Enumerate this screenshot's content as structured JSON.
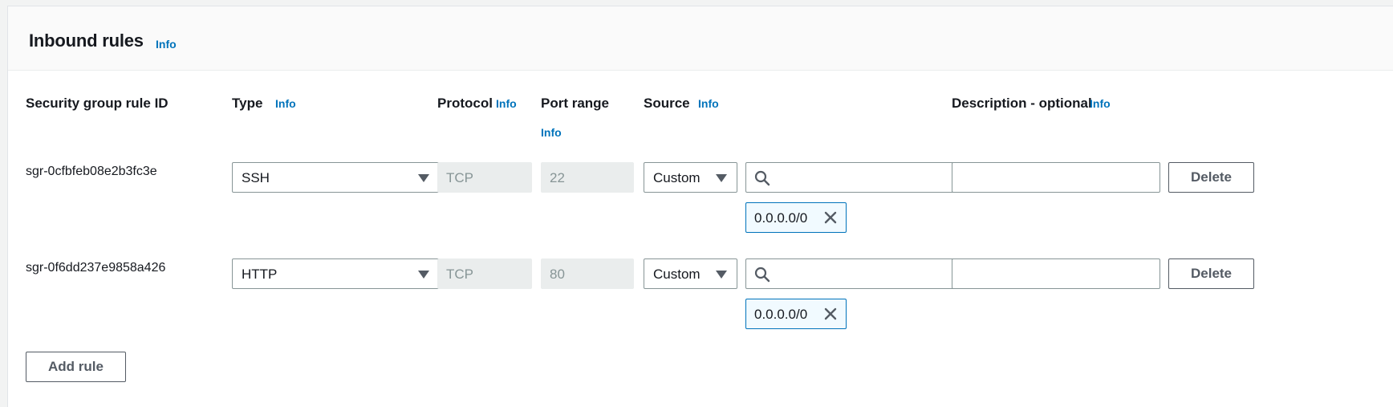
{
  "section": {
    "title": "Inbound rules",
    "info_label": "Info"
  },
  "columns": {
    "rule_id": "Security group rule ID",
    "type": "Type",
    "protocol": "Protocol",
    "port_range": "Port range",
    "source": "Source",
    "description": "Description - optional",
    "info_label": "Info"
  },
  "rules": [
    {
      "rule_id": "sgr-0cfbfeb08e2b3fc3e",
      "type": "SSH",
      "protocol": "TCP",
      "port_range": "22",
      "source_type": "Custom",
      "source_search": "",
      "source_token": "0.0.0.0/0",
      "description": "",
      "delete_label": "Delete"
    },
    {
      "rule_id": "sgr-0f6dd237e9858a426",
      "type": "HTTP",
      "protocol": "TCP",
      "port_range": "80",
      "source_type": "Custom",
      "source_search": "",
      "source_token": "0.0.0.0/0",
      "description": "",
      "delete_label": "Delete"
    }
  ],
  "actions": {
    "add_rule_label": "Add rule"
  },
  "icons": {
    "search": "search-icon",
    "remove_token": "close-icon",
    "dropdown": "caret-down-icon"
  },
  "colors": {
    "link": "#0073bb",
    "border": "#879596",
    "token_bg": "#f1faff",
    "disabled_bg": "#eaeded"
  }
}
